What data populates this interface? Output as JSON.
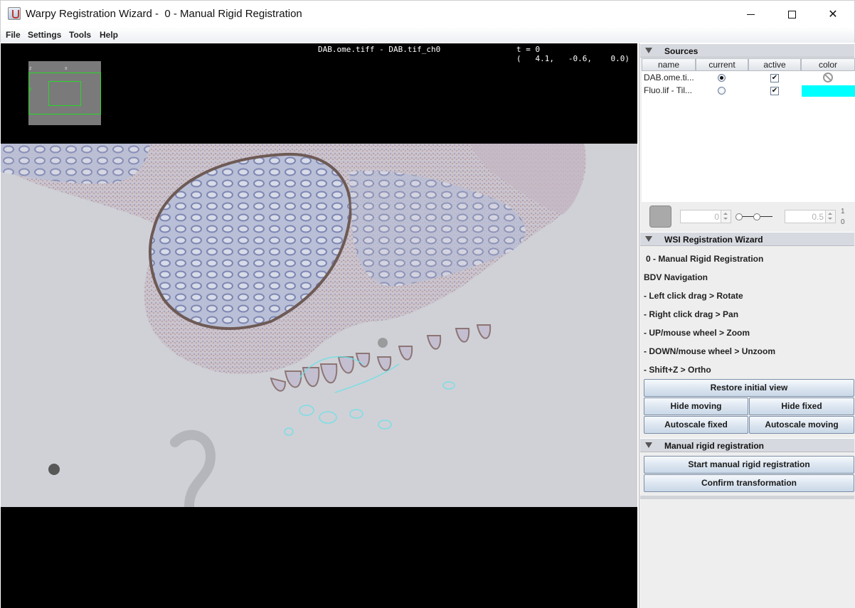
{
  "window": {
    "title": "Warpy Registration Wizard -  0 - Manual Rigid Registration",
    "minimize": "minimize",
    "maximize": "maximize",
    "close": "close"
  },
  "menu": [
    "File",
    "Settings",
    "Tools",
    "Help"
  ],
  "viewer": {
    "source_title": "DAB.ome.tiff - DAB.tif_ch0",
    "time": "t = 0",
    "coords": "(   4.1,   -0.6,    0.0)",
    "overview_axis_x": "x",
    "overview_axis_z": "z",
    "overview_axis_y": "y"
  },
  "sources": {
    "header": "Sources",
    "columns": [
      "name",
      "current",
      "active",
      "color"
    ],
    "rows": [
      {
        "name": "DAB.ome.ti...",
        "current": true,
        "active": true,
        "color": "none"
      },
      {
        "name": "Fluo.lif - Til...",
        "current": false,
        "active": true,
        "color": "#00ffff"
      }
    ]
  },
  "display": {
    "min_value": "0",
    "max_value": "0.5",
    "range_max_label": "1",
    "range_min_label": "0"
  },
  "wizard": {
    "header": "WSI Registration Wizard",
    "step": "0 - Manual Rigid Registration",
    "nav_title": "BDV Navigation",
    "nav_lines": [
      "- Left click drag > Rotate",
      "- Right click drag > Pan",
      "- UP/mouse wheel > Zoom",
      "- DOWN/mouse wheel > Unzoom",
      "- Shift+Z > Ortho"
    ],
    "restore_view": "Restore initial view",
    "hide_moving": "Hide moving",
    "hide_fixed": "Hide fixed",
    "autoscale_fixed": "Autoscale fixed",
    "autoscale_moving": "Autoscale moving"
  },
  "manual": {
    "header": "Manual rigid registration",
    "start": "Start manual rigid registration",
    "confirm": "Confirm transformation"
  }
}
